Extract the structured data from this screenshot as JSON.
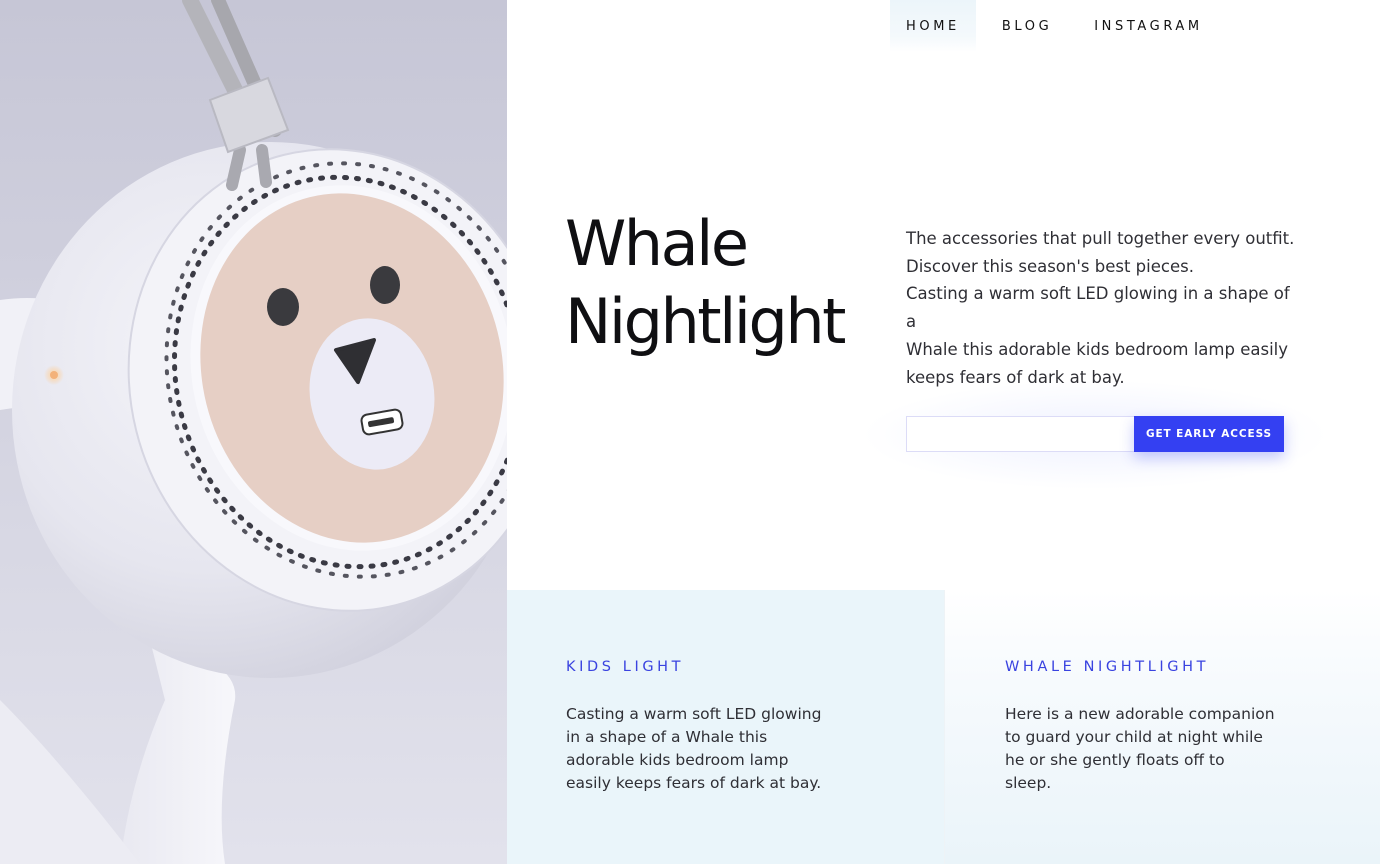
{
  "nav": {
    "items": [
      {
        "label": "HOME",
        "active": true
      },
      {
        "label": "BLOG",
        "active": false
      },
      {
        "label": "INSTAGRAM",
        "active": false
      }
    ]
  },
  "hero": {
    "title_line1": "Whale",
    "title_line2": "Nightlight",
    "description_lines": [
      "The accessories that pull together every outfit.",
      "Discover this season's best pieces.",
      "Casting a warm soft LED glowing in a shape of a",
      "Whale this adorable kids bedroom lamp easily",
      "keeps fears of dark at bay."
    ],
    "image_icon": "nightlight-lamp-photo"
  },
  "signup": {
    "email_value": "",
    "email_placeholder": "",
    "cta_label": "GET EARLY ACCESS"
  },
  "features": [
    {
      "heading": "KIDS LIGHT",
      "text": "Casting a warm soft LED glowing in a shape of a Whale this adorable kids bedroom lamp easily keeps fears of dark at bay."
    },
    {
      "heading": "WHALE NIGHTLIGHT",
      "text": "Here is a new adorable companion to guard your child at night while he or she gently floats off to sleep."
    }
  ],
  "colors": {
    "accent": "#3440f2",
    "heading_accent": "#3a43e0",
    "card_bg": "#eaf5fa",
    "nav_active_bg": "#ecf5fa",
    "face_pink": "#e6cfc5"
  }
}
